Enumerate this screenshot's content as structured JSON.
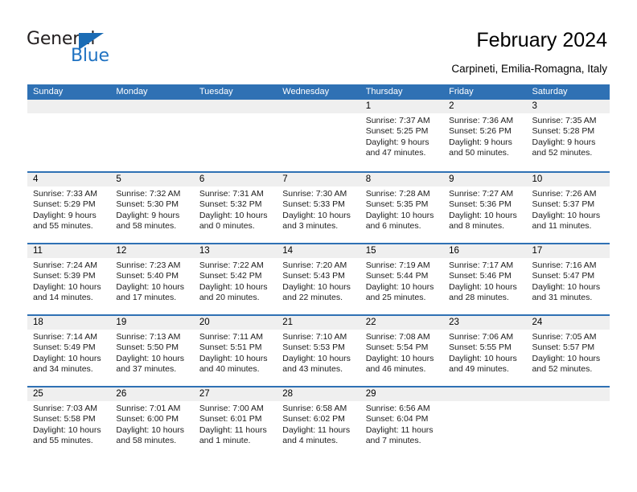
{
  "logo": {
    "word_top": "General",
    "word_bottom": "Blue",
    "triangle_color": "#1b6cb5",
    "blue_text_color": "#1f72c2"
  },
  "header": {
    "title": "February 2024",
    "subtitle": "Carpineti, Emilia-Romagna, Italy"
  },
  "theme": {
    "header_blue": "#2f71b4",
    "date_band_grey": "#efefef",
    "cell_white": "#ffffff"
  },
  "calendar": {
    "day_headers": [
      "Sunday",
      "Monday",
      "Tuesday",
      "Wednesday",
      "Thursday",
      "Friday",
      "Saturday"
    ],
    "weeks": [
      [
        {
          "day": "",
          "lines": []
        },
        {
          "day": "",
          "lines": []
        },
        {
          "day": "",
          "lines": []
        },
        {
          "day": "",
          "lines": []
        },
        {
          "day": "1",
          "lines": [
            "Sunrise: 7:37 AM",
            "Sunset: 5:25 PM",
            "Daylight: 9 hours",
            "and 47 minutes."
          ]
        },
        {
          "day": "2",
          "lines": [
            "Sunrise: 7:36 AM",
            "Sunset: 5:26 PM",
            "Daylight: 9 hours",
            "and 50 minutes."
          ]
        },
        {
          "day": "3",
          "lines": [
            "Sunrise: 7:35 AM",
            "Sunset: 5:28 PM",
            "Daylight: 9 hours",
            "and 52 minutes."
          ]
        }
      ],
      [
        {
          "day": "4",
          "lines": [
            "Sunrise: 7:33 AM",
            "Sunset: 5:29 PM",
            "Daylight: 9 hours",
            "and 55 minutes."
          ]
        },
        {
          "day": "5",
          "lines": [
            "Sunrise: 7:32 AM",
            "Sunset: 5:30 PM",
            "Daylight: 9 hours",
            "and 58 minutes."
          ]
        },
        {
          "day": "6",
          "lines": [
            "Sunrise: 7:31 AM",
            "Sunset: 5:32 PM",
            "Daylight: 10 hours",
            "and 0 minutes."
          ]
        },
        {
          "day": "7",
          "lines": [
            "Sunrise: 7:30 AM",
            "Sunset: 5:33 PM",
            "Daylight: 10 hours",
            "and 3 minutes."
          ]
        },
        {
          "day": "8",
          "lines": [
            "Sunrise: 7:28 AM",
            "Sunset: 5:35 PM",
            "Daylight: 10 hours",
            "and 6 minutes."
          ]
        },
        {
          "day": "9",
          "lines": [
            "Sunrise: 7:27 AM",
            "Sunset: 5:36 PM",
            "Daylight: 10 hours",
            "and 8 minutes."
          ]
        },
        {
          "day": "10",
          "lines": [
            "Sunrise: 7:26 AM",
            "Sunset: 5:37 PM",
            "Daylight: 10 hours",
            "and 11 minutes."
          ]
        }
      ],
      [
        {
          "day": "11",
          "lines": [
            "Sunrise: 7:24 AM",
            "Sunset: 5:39 PM",
            "Daylight: 10 hours",
            "and 14 minutes."
          ]
        },
        {
          "day": "12",
          "lines": [
            "Sunrise: 7:23 AM",
            "Sunset: 5:40 PM",
            "Daylight: 10 hours",
            "and 17 minutes."
          ]
        },
        {
          "day": "13",
          "lines": [
            "Sunrise: 7:22 AM",
            "Sunset: 5:42 PM",
            "Daylight: 10 hours",
            "and 20 minutes."
          ]
        },
        {
          "day": "14",
          "lines": [
            "Sunrise: 7:20 AM",
            "Sunset: 5:43 PM",
            "Daylight: 10 hours",
            "and 22 minutes."
          ]
        },
        {
          "day": "15",
          "lines": [
            "Sunrise: 7:19 AM",
            "Sunset: 5:44 PM",
            "Daylight: 10 hours",
            "and 25 minutes."
          ]
        },
        {
          "day": "16",
          "lines": [
            "Sunrise: 7:17 AM",
            "Sunset: 5:46 PM",
            "Daylight: 10 hours",
            "and 28 minutes."
          ]
        },
        {
          "day": "17",
          "lines": [
            "Sunrise: 7:16 AM",
            "Sunset: 5:47 PM",
            "Daylight: 10 hours",
            "and 31 minutes."
          ]
        }
      ],
      [
        {
          "day": "18",
          "lines": [
            "Sunrise: 7:14 AM",
            "Sunset: 5:49 PM",
            "Daylight: 10 hours",
            "and 34 minutes."
          ]
        },
        {
          "day": "19",
          "lines": [
            "Sunrise: 7:13 AM",
            "Sunset: 5:50 PM",
            "Daylight: 10 hours",
            "and 37 minutes."
          ]
        },
        {
          "day": "20",
          "lines": [
            "Sunrise: 7:11 AM",
            "Sunset: 5:51 PM",
            "Daylight: 10 hours",
            "and 40 minutes."
          ]
        },
        {
          "day": "21",
          "lines": [
            "Sunrise: 7:10 AM",
            "Sunset: 5:53 PM",
            "Daylight: 10 hours",
            "and 43 minutes."
          ]
        },
        {
          "day": "22",
          "lines": [
            "Sunrise: 7:08 AM",
            "Sunset: 5:54 PM",
            "Daylight: 10 hours",
            "and 46 minutes."
          ]
        },
        {
          "day": "23",
          "lines": [
            "Sunrise: 7:06 AM",
            "Sunset: 5:55 PM",
            "Daylight: 10 hours",
            "and 49 minutes."
          ]
        },
        {
          "day": "24",
          "lines": [
            "Sunrise: 7:05 AM",
            "Sunset: 5:57 PM",
            "Daylight: 10 hours",
            "and 52 minutes."
          ]
        }
      ],
      [
        {
          "day": "25",
          "lines": [
            "Sunrise: 7:03 AM",
            "Sunset: 5:58 PM",
            "Daylight: 10 hours",
            "and 55 minutes."
          ]
        },
        {
          "day": "26",
          "lines": [
            "Sunrise: 7:01 AM",
            "Sunset: 6:00 PM",
            "Daylight: 10 hours",
            "and 58 minutes."
          ]
        },
        {
          "day": "27",
          "lines": [
            "Sunrise: 7:00 AM",
            "Sunset: 6:01 PM",
            "Daylight: 11 hours",
            "and 1 minute."
          ]
        },
        {
          "day": "28",
          "lines": [
            "Sunrise: 6:58 AM",
            "Sunset: 6:02 PM",
            "Daylight: 11 hours",
            "and 4 minutes."
          ]
        },
        {
          "day": "29",
          "lines": [
            "Sunrise: 6:56 AM",
            "Sunset: 6:04 PM",
            "Daylight: 11 hours",
            "and 7 minutes."
          ]
        },
        {
          "day": "",
          "lines": []
        },
        {
          "day": "",
          "lines": []
        }
      ]
    ]
  }
}
